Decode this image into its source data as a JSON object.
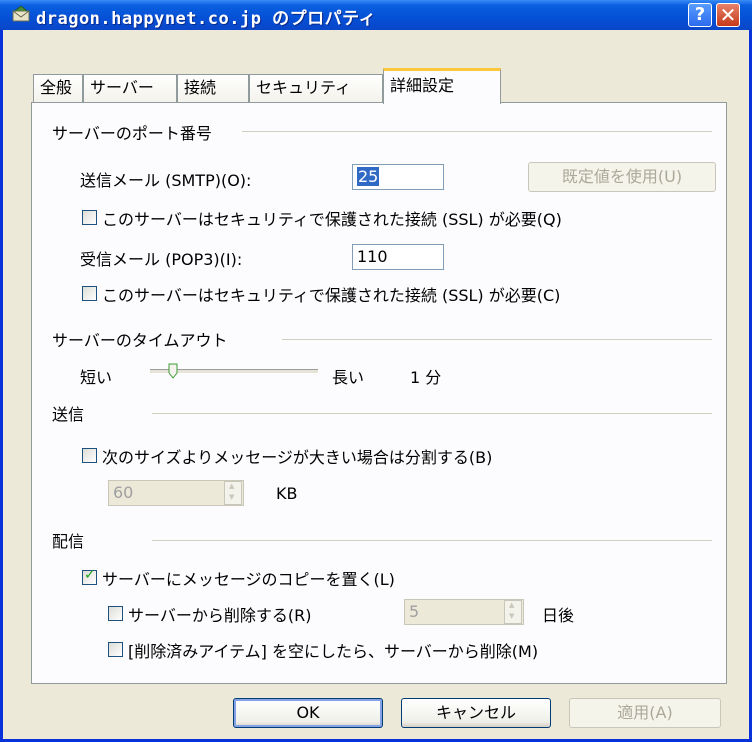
{
  "title": "dragon.happynet.co.jp のプロパティ",
  "tabs": [
    "全般",
    "サーバー",
    "接続",
    "セキュリティ",
    "詳細設定"
  ],
  "active_tab": "詳細設定",
  "ports": {
    "group": "サーバーのポート番号",
    "smtp_label": "送信メール (SMTP)(O):",
    "smtp_value": "25",
    "default_button": "既定値を使用(U)",
    "ssl_smtp_label": "このサーバーはセキュリティで保護された接続 (SSL) が必要(Q)",
    "pop3_label": "受信メール (POP3)(I):",
    "pop3_value": "110",
    "ssl_pop3_label": "このサーバーはセキュリティで保護された接続 (SSL) が必要(C)"
  },
  "timeout": {
    "group": "サーバーのタイムアウト",
    "short": "短い",
    "long": "長い",
    "value": "1 分",
    "slider_level": 0.1
  },
  "send": {
    "group": "送信",
    "split_label": "次のサイズよりメッセージが大きい場合は分割する(B)",
    "split_checked": false,
    "size_value": "60",
    "unit": "KB"
  },
  "delivery": {
    "group": "配信",
    "leave_copy_label": "サーバーにメッセージのコピーを置く(L)",
    "leave_copy_checked": true,
    "remove_after_label": "サーバーから削除する(R)",
    "remove_after_checked": false,
    "days_value": "5",
    "days_unit": "日後",
    "remove_when_deleted_label": "[削除済みアイテム] を空にしたら、サーバーから削除(M)",
    "remove_when_deleted_checked": false
  },
  "buttons": {
    "ok": "OK",
    "cancel": "キャンセル",
    "apply": "適用(A)"
  }
}
